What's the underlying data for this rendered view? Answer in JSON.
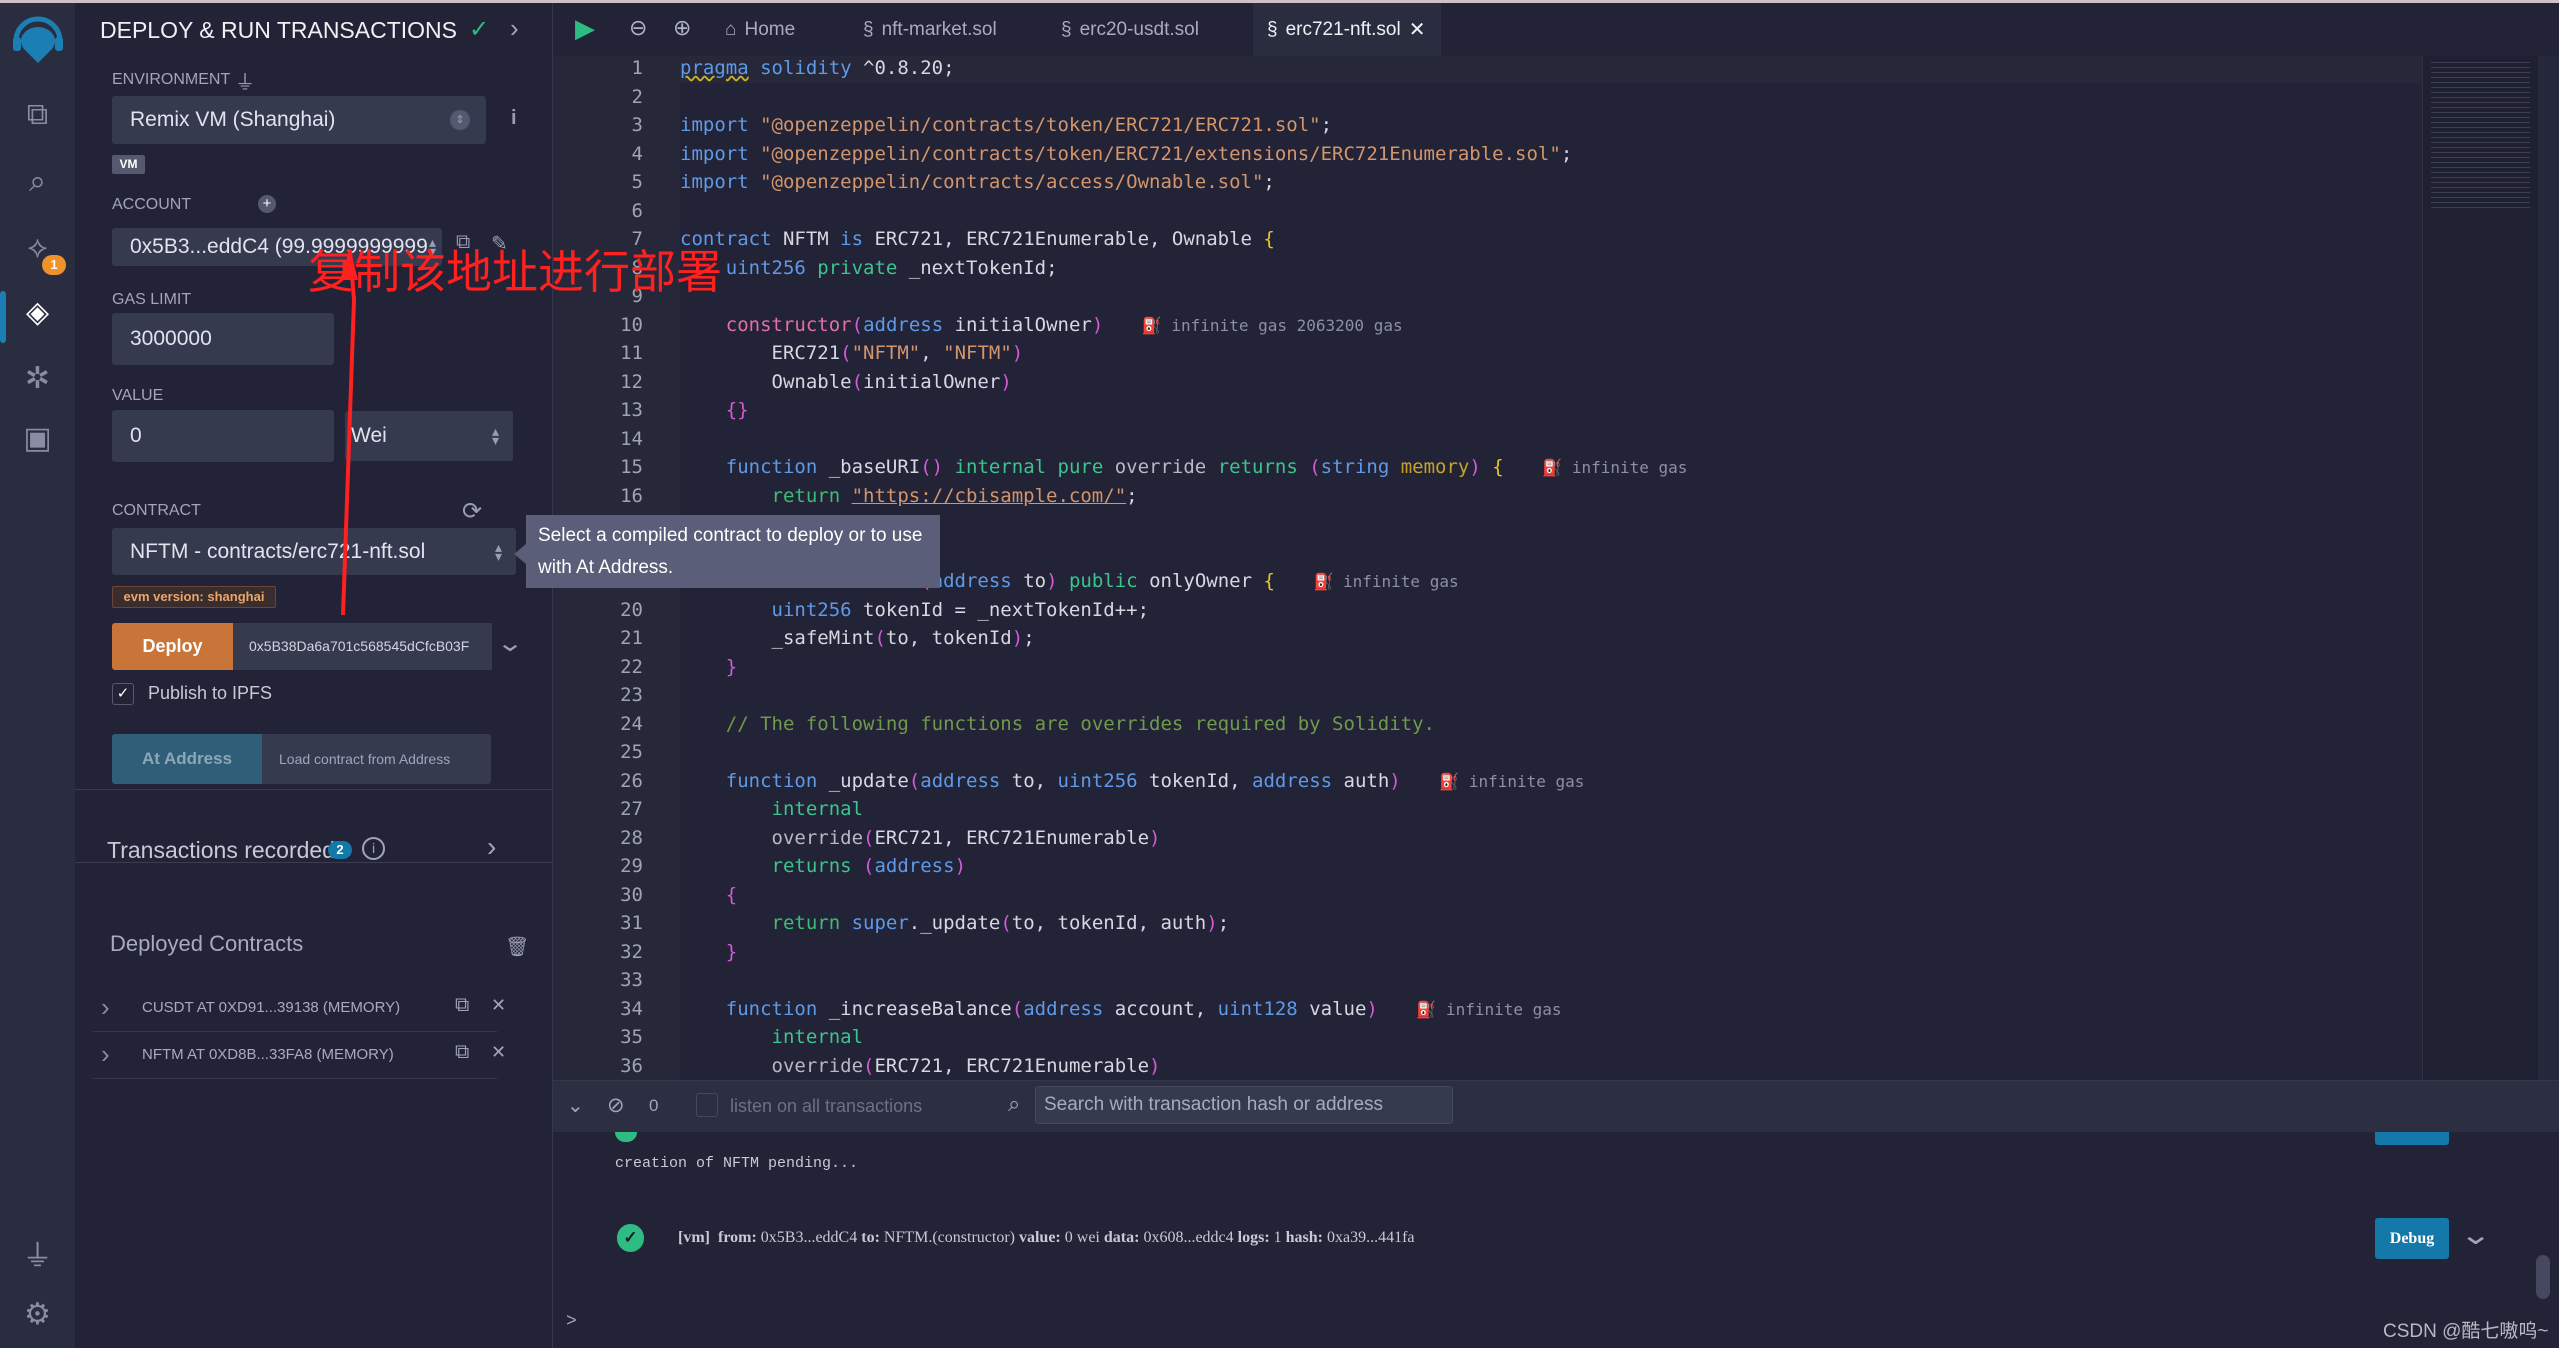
{
  "colors": {
    "accent": "#1478a8",
    "deploy": "#c97539",
    "success": "#2dbd83",
    "annotation": "#ff2020"
  },
  "iconbar": {
    "items": [
      "remix-logo",
      "file-explorer",
      "search",
      "solidity-compiler",
      "deploy-run",
      "debugger",
      "learneth",
      "plugin-manager",
      "settings"
    ],
    "compiler_badge": "1"
  },
  "panel": {
    "title": "DEPLOY & RUN TRANSACTIONS",
    "environment": {
      "label": "ENVIRONMENT",
      "value": "Remix VM (Shanghai)",
      "badge": "VM"
    },
    "account": {
      "label": "ACCOUNT",
      "value": "0x5B3...eddC4 (99.9999999999"
    },
    "gas_limit": {
      "label": "GAS LIMIT",
      "value": "3000000"
    },
    "value": {
      "label": "VALUE",
      "value": "0",
      "unit": "Wei"
    },
    "contract": {
      "label": "CONTRACT",
      "value": "NFTM - contracts/erc721-nft.sol",
      "evm_badge": "evm version: shanghai"
    },
    "tooltip": "Select a compiled contract to deploy or to use with At Address.",
    "deploy": {
      "label": "Deploy",
      "arg": "0x5B38Da6a701c568545dCfcB03F"
    },
    "publish": {
      "label": "Publish to IPFS",
      "checked": true
    },
    "at_address": {
      "label": "At Address",
      "placeholder": "Load contract from Address"
    },
    "transactions": {
      "label": "Transactions recorded",
      "count": "2"
    },
    "deployed": {
      "label": "Deployed Contracts",
      "items": [
        "CUSDT AT 0XD91...39138 (MEMORY)",
        "NFTM AT 0XD8B...33FA8 (MEMORY)"
      ]
    }
  },
  "annotation": "复制该地址进行部署",
  "tabs": {
    "home": "Home",
    "files": [
      "nft-market.sol",
      "erc20-usdt.sol",
      "erc721-nft.sol"
    ],
    "active": "erc721-nft.sol"
  },
  "editor": {
    "lines": [
      {
        "n": 1,
        "t": [
          [
            "pragma",
            "k sq"
          ],
          [
            " solidity ",
            "k"
          ],
          [
            "^0.8.20;",
            "pl"
          ]
        ]
      },
      {
        "n": 2,
        "t": []
      },
      {
        "n": 3,
        "t": [
          [
            "import ",
            "k"
          ],
          [
            "\"@openzeppelin/contracts/token/ERC721/ERC721.sol\"",
            "s"
          ],
          [
            ";",
            "pl"
          ]
        ]
      },
      {
        "n": 4,
        "t": [
          [
            "import ",
            "k"
          ],
          [
            "\"@openzeppelin/contracts/token/ERC721/extensions/ERC721Enumerable.sol\"",
            "s"
          ],
          [
            ";",
            "pl"
          ]
        ]
      },
      {
        "n": 5,
        "t": [
          [
            "import ",
            "k"
          ],
          [
            "\"@openzeppelin/contracts/access/Ownable.sol\"",
            "s"
          ],
          [
            ";",
            "pl"
          ]
        ]
      },
      {
        "n": 6,
        "t": []
      },
      {
        "n": 7,
        "t": [
          [
            "contract ",
            "k"
          ],
          [
            "NFTM ",
            "pl"
          ],
          [
            "is ",
            "k"
          ],
          [
            "ERC721, ERC721Enumerable, Ownable ",
            "pl"
          ],
          [
            "{",
            "b"
          ]
        ]
      },
      {
        "n": 8,
        "t": [
          [
            "    ",
            "pl"
          ],
          [
            "uint256 ",
            "t"
          ],
          [
            "private ",
            "m"
          ],
          [
            "_nextTokenId;",
            "pl"
          ]
        ]
      },
      {
        "n": 9,
        "t": []
      },
      {
        "n": 10,
        "t": [
          [
            "    ",
            "pl"
          ],
          [
            "constructor",
            "c"
          ],
          [
            "(",
            "p"
          ],
          [
            "address ",
            "t"
          ],
          [
            "initialOwner",
            "pl"
          ],
          [
            ")",
            "p"
          ],
          [
            "infinite gas 2063200 gas",
            "g"
          ]
        ]
      },
      {
        "n": 11,
        "t": [
          [
            "        ERC721",
            "pl"
          ],
          [
            "(",
            "p"
          ],
          [
            "\"NFTM\"",
            "s"
          ],
          [
            ", ",
            "pl"
          ],
          [
            "\"NFTM\"",
            "s"
          ],
          [
            ")",
            "p"
          ]
        ]
      },
      {
        "n": 12,
        "t": [
          [
            "        Ownable",
            "pl"
          ],
          [
            "(",
            "p"
          ],
          [
            "initialOwner",
            "pl"
          ],
          [
            ")",
            "p"
          ]
        ]
      },
      {
        "n": 13,
        "t": [
          [
            "    ",
            "pl"
          ],
          [
            "{}",
            "p"
          ]
        ]
      },
      {
        "n": 14,
        "t": []
      },
      {
        "n": 15,
        "t": [
          [
            "    ",
            "pl"
          ],
          [
            "function",
            "k"
          ],
          [
            " _baseURI",
            "pl"
          ],
          [
            "()",
            "p"
          ],
          [
            " ",
            "pl"
          ],
          [
            "internal ",
            "m"
          ],
          [
            "pure ",
            "m"
          ],
          [
            "override ",
            "o"
          ],
          [
            "returns ",
            "m"
          ],
          [
            "(",
            "p"
          ],
          [
            "string ",
            "t"
          ],
          [
            "memory",
            "y"
          ],
          [
            ")",
            "p"
          ],
          [
            " ",
            "pl"
          ],
          [
            "{",
            "b"
          ],
          [
            "infinite gas",
            "g"
          ]
        ]
      },
      {
        "n": 16,
        "t": [
          [
            "        ",
            "pl"
          ],
          [
            "return ",
            "r"
          ],
          [
            "\"https://cbisample.com/\"",
            "s ul"
          ],
          [
            ";",
            "pl"
          ]
        ]
      },
      {
        "n": 17,
        "t": []
      },
      {
        "n": 18,
        "t": []
      },
      {
        "n": 19,
        "t": [
          [
            "                     ",
            "pl"
          ],
          [
            "(",
            "p"
          ],
          [
            "address ",
            "t"
          ],
          [
            "to",
            "pl"
          ],
          [
            ")",
            "p"
          ],
          [
            " ",
            "pl"
          ],
          [
            "public ",
            "m"
          ],
          [
            "onlyOwner ",
            "pl"
          ],
          [
            "{",
            "b"
          ],
          [
            "infinite gas",
            "g"
          ]
        ]
      },
      {
        "n": 20,
        "t": [
          [
            "        ",
            "pl"
          ],
          [
            "uint256 ",
            "t"
          ],
          [
            "tokenId = _nextTokenId++;",
            "pl"
          ]
        ]
      },
      {
        "n": 21,
        "t": [
          [
            "        _safeMint",
            "pl"
          ],
          [
            "(",
            "p"
          ],
          [
            "to, tokenId",
            "pl"
          ],
          [
            ")",
            "p"
          ],
          [
            ";",
            "pl"
          ]
        ]
      },
      {
        "n": 22,
        "t": [
          [
            "    ",
            "pl"
          ],
          [
            "}",
            "p"
          ]
        ]
      },
      {
        "n": 23,
        "t": []
      },
      {
        "n": 24,
        "t": [
          [
            "    ",
            "pl"
          ],
          [
            "// The following functions are overrides required by Solidity.",
            "cm"
          ]
        ]
      },
      {
        "n": 25,
        "t": []
      },
      {
        "n": 26,
        "t": [
          [
            "    ",
            "pl"
          ],
          [
            "function",
            "k"
          ],
          [
            " _update",
            "pl"
          ],
          [
            "(",
            "p"
          ],
          [
            "address ",
            "t"
          ],
          [
            "to, ",
            "pl"
          ],
          [
            "uint256 ",
            "t"
          ],
          [
            "tokenId, ",
            "pl"
          ],
          [
            "address ",
            "t"
          ],
          [
            "auth",
            "pl"
          ],
          [
            ")",
            "p"
          ],
          [
            "infinite gas",
            "g"
          ]
        ]
      },
      {
        "n": 27,
        "t": [
          [
            "        ",
            "pl"
          ],
          [
            "internal",
            "m"
          ]
        ]
      },
      {
        "n": 28,
        "t": [
          [
            "        ",
            "pl"
          ],
          [
            "override",
            "o"
          ],
          [
            "(",
            "p"
          ],
          [
            "ERC721, ERC721Enumerable",
            "pl"
          ],
          [
            ")",
            "p"
          ]
        ]
      },
      {
        "n": 29,
        "t": [
          [
            "        ",
            "pl"
          ],
          [
            "returns ",
            "m"
          ],
          [
            "(",
            "p"
          ],
          [
            "address",
            "t"
          ],
          [
            ")",
            "p"
          ]
        ]
      },
      {
        "n": 30,
        "t": [
          [
            "    ",
            "pl"
          ],
          [
            "{",
            "p"
          ]
        ]
      },
      {
        "n": 31,
        "t": [
          [
            "        ",
            "pl"
          ],
          [
            "return ",
            "r"
          ],
          [
            "super",
            "t"
          ],
          [
            "._update",
            "pl"
          ],
          [
            "(",
            "p"
          ],
          [
            "to, tokenId, auth",
            "pl"
          ],
          [
            ")",
            "p"
          ],
          [
            ";",
            "pl"
          ]
        ]
      },
      {
        "n": 32,
        "t": [
          [
            "    ",
            "pl"
          ],
          [
            "}",
            "p"
          ]
        ]
      },
      {
        "n": 33,
        "t": []
      },
      {
        "n": 34,
        "t": [
          [
            "    ",
            "pl"
          ],
          [
            "function",
            "k"
          ],
          [
            " _increaseBalance",
            "pl"
          ],
          [
            "(",
            "p"
          ],
          [
            "address ",
            "t"
          ],
          [
            "account, ",
            "pl"
          ],
          [
            "uint128 ",
            "t"
          ],
          [
            "value",
            "pl"
          ],
          [
            ")",
            "p"
          ],
          [
            "infinite gas",
            "g"
          ]
        ]
      },
      {
        "n": 35,
        "t": [
          [
            "        ",
            "pl"
          ],
          [
            "internal",
            "m"
          ]
        ]
      },
      {
        "n": 36,
        "t": [
          [
            "        ",
            "pl"
          ],
          [
            "override",
            "o"
          ],
          [
            "(",
            "p"
          ],
          [
            "ERC721, ERC721Enumerable",
            "pl"
          ],
          [
            ")",
            "p"
          ]
        ]
      }
    ]
  },
  "terminal": {
    "count": "0",
    "listen_label": "listen on all transactions",
    "search_placeholder": "Search with transaction hash or address",
    "pending": "creation of NFTM pending...",
    "tx": {
      "vm": "[vm]",
      "from_k": "from:",
      "from": "0x5B3...eddC4",
      "to_k": "to:",
      "to": "NFTM.(constructor)",
      "value_k": "value:",
      "value": "0 wei",
      "data_k": "data:",
      "data": "0x608...eddc4",
      "logs_k": "logs:",
      "logs": "1",
      "hash_k": "hash:",
      "hash": "0xa39...441fa"
    },
    "debug": "Debug",
    "prompt": ">"
  },
  "watermark": "CSDN @酷七嗷呜~"
}
